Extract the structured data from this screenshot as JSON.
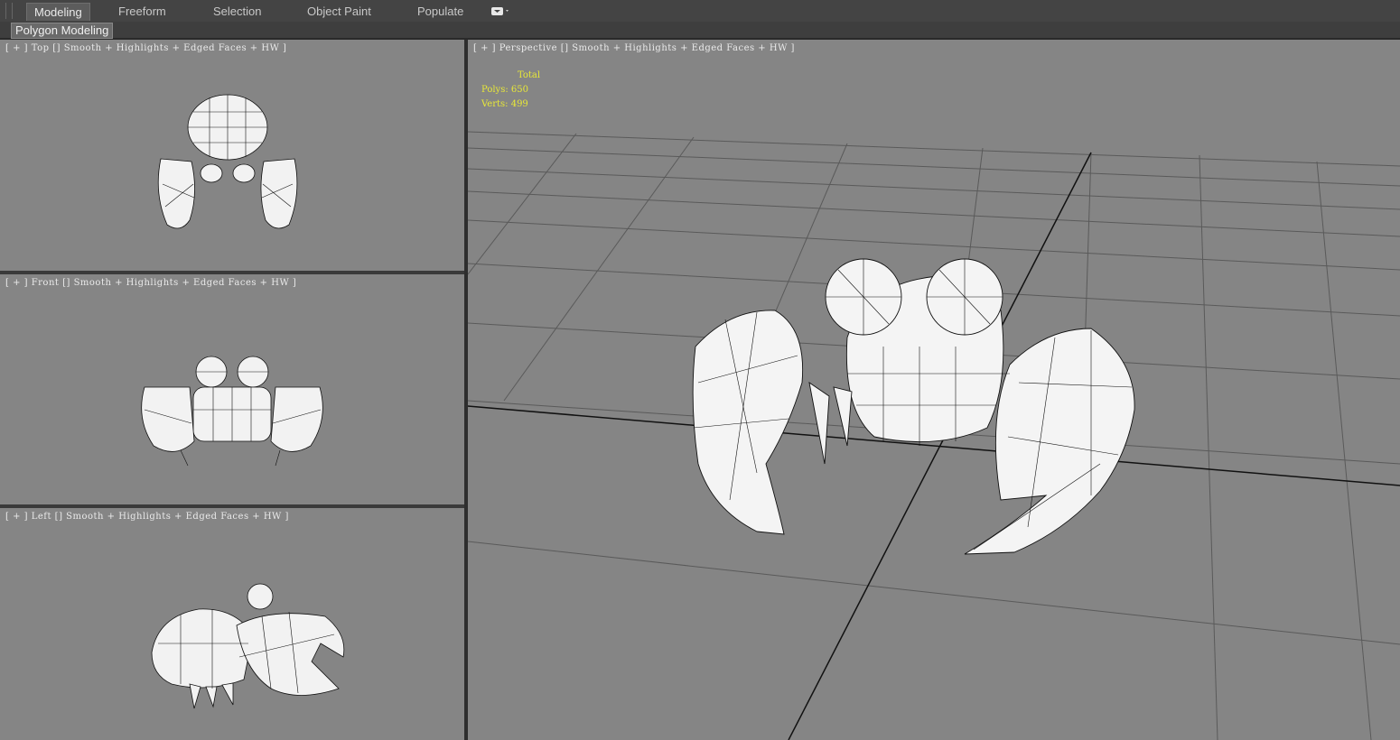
{
  "ribbon": {
    "tabs": [
      {
        "label": "Modeling",
        "active": true
      },
      {
        "label": "Freeform"
      },
      {
        "label": "Selection"
      },
      {
        "label": "Object Paint"
      },
      {
        "label": "Populate"
      }
    ]
  },
  "subpanel": {
    "label": "Polygon Modeling"
  },
  "viewports": {
    "top": {
      "label": "[ + ] Top [] Smooth + Highlights + Edged Faces + HW ]"
    },
    "front": {
      "label": "[ + ] Front [] Smooth + Highlights + Edged Faces + HW ]"
    },
    "left": {
      "label": "[ + ] Left [] Smooth + Highlights + Edged Faces + HW ]"
    },
    "perspective": {
      "label": "[ + ] Perspective [] Smooth + Highlights + Edged Faces + HW ]",
      "stats": {
        "title": "Total",
        "polys": "Polys: 650",
        "verts": "Verts: 499"
      }
    }
  },
  "colors": {
    "viewport_bg": "#858585",
    "stats_text": "#e8e838",
    "ui_dark": "#3a3a3a"
  }
}
